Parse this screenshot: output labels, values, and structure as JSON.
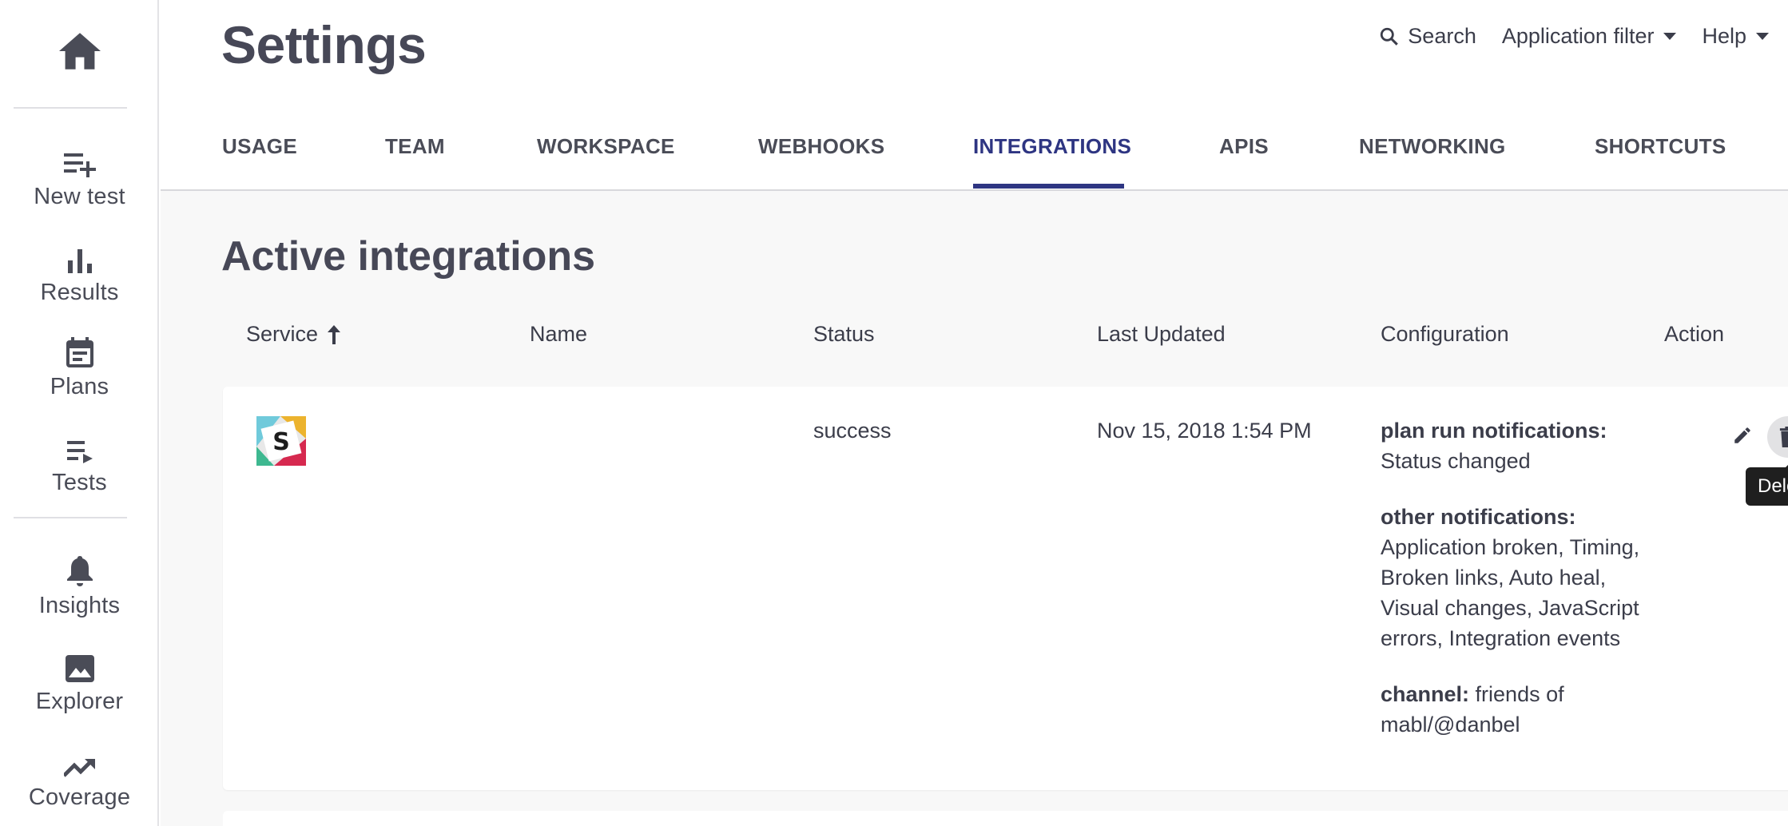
{
  "sidebar": {
    "home_icon": "home-icon",
    "items": [
      {
        "label": "New test",
        "icon": "playlist-add-icon"
      },
      {
        "label": "Results",
        "icon": "bar-chart-icon"
      },
      {
        "label": "Plans",
        "icon": "calendar-icon"
      },
      {
        "label": "Tests",
        "icon": "playlist-play-icon"
      },
      {
        "label": "Insights",
        "icon": "bell-icon"
      },
      {
        "label": "Explorer",
        "icon": "image-icon"
      },
      {
        "label": "Coverage",
        "icon": "trending-up-icon"
      }
    ]
  },
  "header": {
    "title": "Settings",
    "search_label": "Search",
    "app_filter_label": "Application filter",
    "help_label": "Help"
  },
  "tabs": [
    {
      "label": "USAGE",
      "active": false
    },
    {
      "label": "TEAM",
      "active": false
    },
    {
      "label": "WORKSPACE",
      "active": false
    },
    {
      "label": "WEBHOOKS",
      "active": false
    },
    {
      "label": "INTEGRATIONS",
      "active": true
    },
    {
      "label": "APIS",
      "active": false
    },
    {
      "label": "NETWORKING",
      "active": false
    },
    {
      "label": "SHORTCUTS",
      "active": false
    }
  ],
  "section": {
    "title": "Active integrations"
  },
  "table": {
    "columns": [
      "Service",
      "Name",
      "Status",
      "Last Updated",
      "Configuration",
      "Action"
    ],
    "sort_column": "Service",
    "rows": [
      {
        "service_icon": "slack-logo",
        "name": "",
        "status": "success",
        "last_updated": "Nov 15, 2018 1:54 PM",
        "configuration": [
          {
            "key": "plan run notifications:",
            "value": "Status changed"
          },
          {
            "key": "other notifications:",
            "value": "Application broken, Timing, Broken links, Auto heal, Visual changes, JavaScript errors, Integration events"
          },
          {
            "key": "channel:",
            "value": "friends of mabl/@danbel"
          }
        ],
        "actions": [
          "pencil-icon",
          "trash-icon"
        ]
      }
    ]
  },
  "tooltip": {
    "text": "Delete"
  },
  "colors": {
    "accent": "#2e3582",
    "text": "#3b3d4a",
    "background": "#f8f8f8"
  }
}
